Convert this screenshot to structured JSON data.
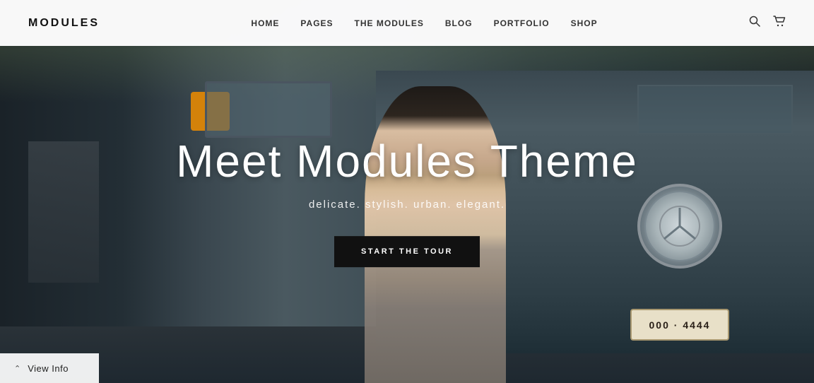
{
  "brand": {
    "logo": "MODULES"
  },
  "nav": {
    "links": [
      {
        "label": "HOME",
        "id": "home"
      },
      {
        "label": "PAGES",
        "id": "pages"
      },
      {
        "label": "THE MODULES",
        "id": "the-modules"
      },
      {
        "label": "BLOG",
        "id": "blog"
      },
      {
        "label": "PORTFOLIO",
        "id": "portfolio"
      },
      {
        "label": "SHOP",
        "id": "shop"
      }
    ],
    "search_icon": "🔍",
    "cart_icon": "🛒"
  },
  "hero": {
    "title": "Meet Modules Theme",
    "subtitle": "delicate. stylish. urban. elegant.",
    "cta_button": "START THE TOUR"
  },
  "license_plate": {
    "text": "000 · 4444"
  },
  "footer": {
    "view_info": "View Info"
  }
}
